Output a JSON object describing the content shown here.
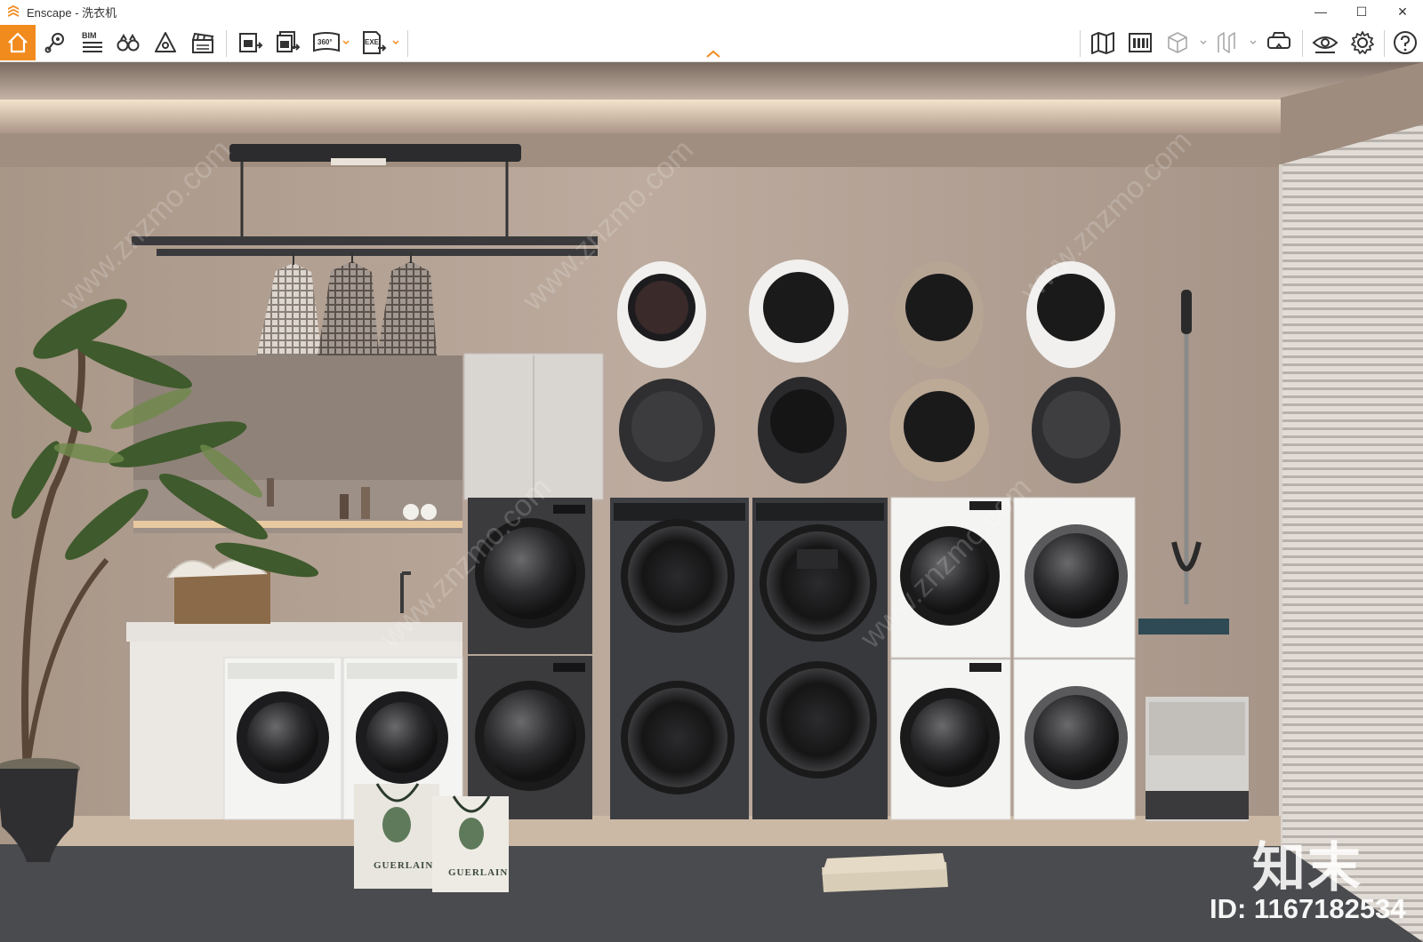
{
  "window": {
    "app_name": "Enscape",
    "title": "Enscape - 洗衣机",
    "minimize_symbol": "—",
    "maximize_symbol": "☐",
    "close_symbol": "✕"
  },
  "toolbar": {
    "bim_label": "BIM",
    "badge_360": "360°",
    "badge_exe": "EXE",
    "left_tools": [
      "home-icon",
      "location-icon",
      "bim-icon",
      "binoculars-icon",
      "light-icon",
      "clapper-icon",
      "screenshot-export-icon",
      "batch-export-icon",
      "panorama-360-icon",
      "exe-export-icon"
    ],
    "right_tools": [
      "map-icon",
      "library-icon",
      "cube-view-icon",
      "section-icon",
      "vr-headset-icon",
      "visual-settings-icon",
      "settings-gear-icon",
      "help-icon"
    ]
  },
  "viewport": {
    "watermark_brand": "知末",
    "watermark_id": "ID: 1167182534",
    "watermark_site": "www.znzmo.com",
    "bag_brand": "GUERLAIN"
  },
  "colors": {
    "accent": "#f28b1e",
    "wall": "#b8a89b",
    "floor": "#4a4b4e"
  }
}
